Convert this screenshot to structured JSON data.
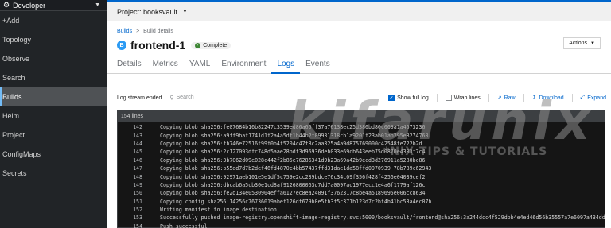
{
  "sidebar": {
    "perspective": "Developer",
    "items": [
      {
        "label": "+Add",
        "active": false
      },
      {
        "label": "Topology",
        "active": false
      },
      {
        "label": "Observe",
        "active": false
      },
      {
        "label": "Search",
        "active": false
      },
      {
        "label": "Builds",
        "active": true
      },
      {
        "label": "Helm",
        "active": false
      },
      {
        "label": "Project",
        "active": false
      },
      {
        "label": "ConfigMaps",
        "active": false
      },
      {
        "label": "Secrets",
        "active": false
      }
    ]
  },
  "project": {
    "label": "Project: booksvault"
  },
  "breadcrumb": {
    "root": "Builds",
    "separator": ">",
    "current": "Build details"
  },
  "resource": {
    "badge": "B",
    "name": "frontend-1",
    "status": "Complete"
  },
  "actions_label": "Actions",
  "tabs": [
    "Details",
    "Metrics",
    "YAML",
    "Environment",
    "Logs",
    "Events"
  ],
  "active_tab": "Logs",
  "log_toolbar": {
    "status": "Log stream ended.",
    "search_placeholder": "Search",
    "show_full_log": "Show full log",
    "wrap_lines": "Wrap lines",
    "raw": "Raw",
    "download": "Download",
    "expand": "Expand"
  },
  "log": {
    "line_count": "154 lines",
    "lines": [
      {
        "n": "142",
        "t": "Copying blob sha256:fe07684b16b82247c3539ed86a65ff37a76138ec25d380bd80c069a1a4673236"
      },
      {
        "n": "143",
        "t": "Copying blob sha256:a9ff9baf1741d1f2a4a5df1b44b2f09931318cb1a9201f23ab01ab295e8274768"
      },
      {
        "n": "144",
        "t": "Copying blob sha256:fb746e72516f99f0b4f5204c47f8c2aa325a4a9d875769000c42548fe722b2d"
      },
      {
        "n": "145",
        "t": "Copying blob sha256:2c127093dfc748d5aae28bdf3d96936deb033e69cb643eeb75d0870e4333f7c4"
      },
      {
        "n": "146",
        "t": "Copying blob sha256:3b7062d09e028c442f2b85e76286341d9b23a69a42b9ecd3d276911a5280bc86"
      },
      {
        "n": "147",
        "t": "Copying blob sha256:b55ed7d7b2def46fd4870c4bb57437ffd31dae1da58ffd0970939 78b789c62943"
      },
      {
        "n": "148",
        "t": "Copying blob sha256:92971aeb101e5e1df5c759e2cc239bdce76c34c09f356f428f4256e04039cef2"
      },
      {
        "n": "149",
        "t": "Copying blob sha256:dbcab6a5cb30e1cd8af9126800063d7dd7a0097ac1977ecc1e4a6f1779af126c"
      },
      {
        "n": "150",
        "t": "Copying blob sha256:fe2d134e0530904effa6127ec8ea24091f3762317c8be4a5189695e006cc8634"
      },
      {
        "n": "151",
        "t": "Copying config sha256:14256c76736019abef126df679b0e5fb3f5c371b123d7c2bf4b41bc53a4ec07b"
      },
      {
        "n": "152",
        "t": "Writing manifest to image destination"
      },
      {
        "n": "153",
        "t": "Successfully pushed image-registry.openshift-image-registry.svc:5000/booksvault/frontend@sha256:3a244dcc4f529dbb4e4ed46d56b35557a7e6097a434ddd73"
      },
      {
        "n": "154",
        "t": "Push successful"
      }
    ]
  },
  "watermark": {
    "text": "kifarunix",
    "tagline": "*NIX TIPS & TUTORIALS"
  },
  "colors": {
    "accent": "#0066cc",
    "sidebar": "#212427",
    "success": "#3e8635",
    "log_bg": "#151515"
  }
}
